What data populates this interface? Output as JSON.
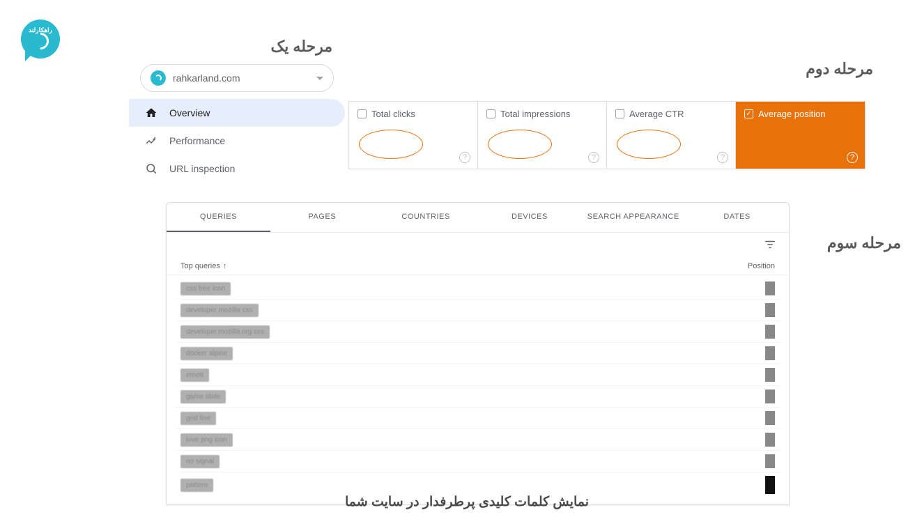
{
  "logo": {
    "brand_text": "راهکارلند"
  },
  "steps": {
    "one": "مرحله یک",
    "two": "مرحله دوم",
    "three": "مرحله سوم"
  },
  "property": {
    "domain": "rahkarland.com"
  },
  "nav": {
    "overview": "Overview",
    "performance": "Performance",
    "url_inspection": "URL inspection"
  },
  "metrics": [
    {
      "label": "Total clicks",
      "checked": false
    },
    {
      "label": "Total impressions",
      "checked": false
    },
    {
      "label": "Average CTR",
      "checked": false
    },
    {
      "label": "Average position",
      "checked": true
    }
  ],
  "tabs": {
    "queries": "QUERIES",
    "pages": "PAGES",
    "countries": "COUNTRIES",
    "devices": "DEVICES",
    "search_appearance": "SEARCH APPEARANCE",
    "dates": "DATES"
  },
  "table": {
    "header_query": "Top queries",
    "header_position": "Position",
    "rows": [
      {
        "q": "css free icon"
      },
      {
        "q": "developer mozilla css"
      },
      {
        "q": "developer.mozilla.org css"
      },
      {
        "q": "docker alpine"
      },
      {
        "q": "emett"
      },
      {
        "q": "game state"
      },
      {
        "q": "grid line"
      },
      {
        "q": "love png icon"
      },
      {
        "q": "no signal"
      },
      {
        "q": "pattern"
      }
    ]
  },
  "footer_caption": "نمایش کلمات کلیدی پرطرفدار در سایت شما"
}
